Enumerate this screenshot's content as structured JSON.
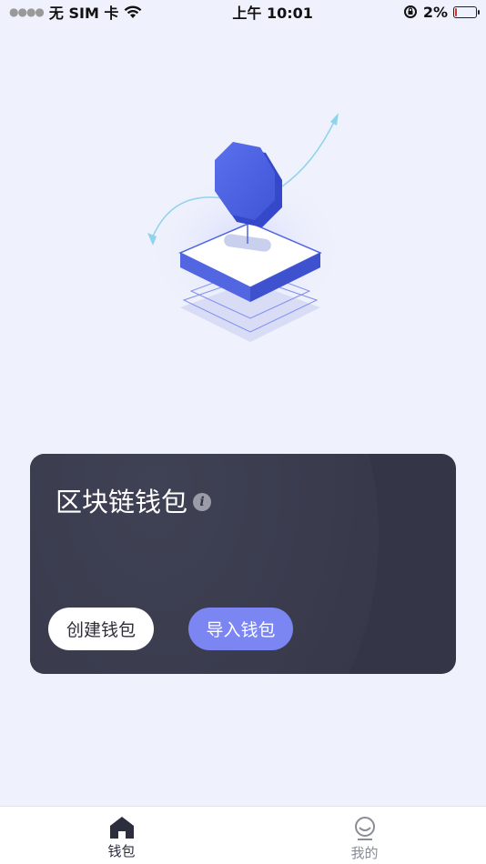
{
  "status_bar": {
    "carrier": "无 SIM 卡",
    "time": "上午 10:01",
    "battery_percent": "2%",
    "battery_level": 0.02
  },
  "card": {
    "title": "区块链钱包",
    "info_icon": "info-icon",
    "create_label": "创建钱包",
    "import_label": "导入钱包"
  },
  "tabs": [
    {
      "label": "钱包",
      "icon": "home-icon",
      "active": true
    },
    {
      "label": "我的",
      "icon": "profile-icon",
      "active": false
    }
  ],
  "colors": {
    "background": "#eff1fc",
    "card": "#343647",
    "accent": "#7b86f2",
    "illustration_blue": "#4f63e0"
  }
}
